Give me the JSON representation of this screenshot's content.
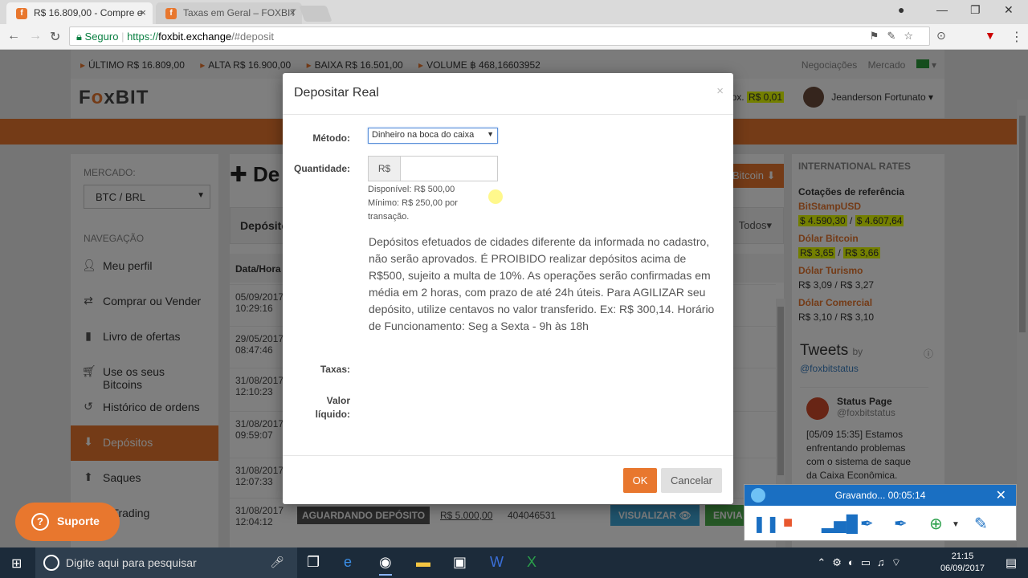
{
  "browser": {
    "tabs": [
      {
        "label": "R$ 16.809,00 - Compre e"
      },
      {
        "label": "Taxas em Geral – FOXBIT"
      }
    ],
    "secure_label": "Seguro",
    "url_scheme": "https://",
    "url_host": "foxbit.exchange",
    "url_path": "/#deposit"
  },
  "ticker": {
    "ultimo": "ÚLTIMO  R$ 16.809,00",
    "alta": "ALTA  R$ 16.900,00",
    "baixa": "BAIXA  R$ 16.501,00",
    "volume": "VOLUME  ฿ 468,16603952",
    "negociacoes": "Negociações",
    "mercado": "Mercado"
  },
  "header": {
    "logo_pre": "F",
    "logo_o": "o",
    "logo_post": "xBIT",
    "balance_label": "ox.",
    "balance": "R$ 0,01",
    "user": "Jeanderson Fortunato ▾"
  },
  "sidebar": {
    "market_label": "MERCADO:",
    "market_value": "BTC / BRL",
    "nav_label": "NAVEGAÇÃO",
    "items": [
      {
        "label": "Meu perfil",
        "icon": "user-icon"
      },
      {
        "label": "Comprar ou Vender",
        "icon": "shuffle-icon"
      },
      {
        "label": "Livro de ofertas",
        "icon": "book-icon"
      },
      {
        "label": "Use os seus Bitcoins",
        "icon": "cart-icon"
      },
      {
        "label": "Histórico de ordens",
        "icon": "history-icon"
      },
      {
        "label": "Depósitos",
        "icon": "download-icon"
      },
      {
        "label": "Saques",
        "icon": "upload-icon"
      },
      {
        "label": "o Trading",
        "icon": "trading-icon"
      }
    ]
  },
  "content": {
    "title": "De",
    "bitcoin_btn": "Bitcoin",
    "tab_label": "Depósito",
    "filter": "Todos▾",
    "col_date": "Data/Hora",
    "rows": [
      {
        "date": "05/09/2017",
        "time": "10:29:16"
      },
      {
        "date": "29/05/2017",
        "time": "08:47:46"
      },
      {
        "date": "31/08/2017",
        "time": "12:10:23"
      },
      {
        "date": "31/08/2017",
        "time": "09:59:07"
      },
      {
        "date": "31/08/2017",
        "time": "12:07:33"
      },
      {
        "date": "31/08/2017",
        "time": "12:04:12",
        "status": "AGUARDANDO DEPÓSITO",
        "amount": "R$ 5.000,00",
        "txid": "404046531",
        "view": "VISUALIZAR",
        "send": "ENVIA"
      }
    ]
  },
  "rates": {
    "heading": "INTERNATIONAL RATES",
    "ref": "Cotações de referência",
    "groups": [
      {
        "name": "BitStampUSD",
        "bid": "$ 4.590,30",
        "ask": "$ 4.607,64"
      },
      {
        "name": "Dólar Bitcoin",
        "bid": "R$ 3,65",
        "ask": "R$ 3,66"
      },
      {
        "name": "Dólar Turismo",
        "bid": "R$ 3,09",
        "ask": "R$ 3,27"
      },
      {
        "name": "Dólar Comercial",
        "bid": "R$ 3,10",
        "ask": "R$ 3,10"
      }
    ],
    "separator": " / "
  },
  "tweets": {
    "title": "Tweets",
    "by": "by",
    "handle": "@foxbitstatus",
    "tweet_name": "Status Page",
    "tweet_handle": "@foxbitstatus",
    "tweet_body": "[05/09 15:35] Estamos enfrentando problemas com o sistema de saque da Caixa Econômica."
  },
  "modal": {
    "title": "Depositar Real",
    "close": "×",
    "method_label": "Método:",
    "method_value": "Dinheiro na boca do caixa",
    "amount_label": "Quantidade:",
    "currency_addon": "R$",
    "amount_value": "",
    "available": "Disponível: R$ 500,00",
    "minimum": "Mínimo: R$ 250,00 por transação.",
    "notice": "Depósitos efetuados de cidades diferente da informada no cadastro, não serão aprovados. É PROIBIDO realizar depósitos acima de R$500, sujeito a multa de 10%. As operações serão confirmadas em média em 2 horas, com prazo de até 24h úteis. Para AGILIZAR seu depósito, utilize centavos no valor transferido. Ex: R$ 300,14. Horário de Funcionamento: Seg a Sexta - 9h às 18h",
    "fees_label": "Taxas:",
    "net_label_1": "Valor",
    "net_label_2": "líquido:",
    "ok": "OK",
    "cancel": "Cancelar"
  },
  "suporte": "Suporte",
  "recorder": {
    "status": "Gravando... 00:05:14"
  },
  "taskbar": {
    "search_placeholder": "Digite aqui para pesquisar",
    "time": "21:15",
    "date": "06/09/2017"
  },
  "colors": {
    "brand": "#e8772e",
    "highlight": "#e6ff00"
  }
}
